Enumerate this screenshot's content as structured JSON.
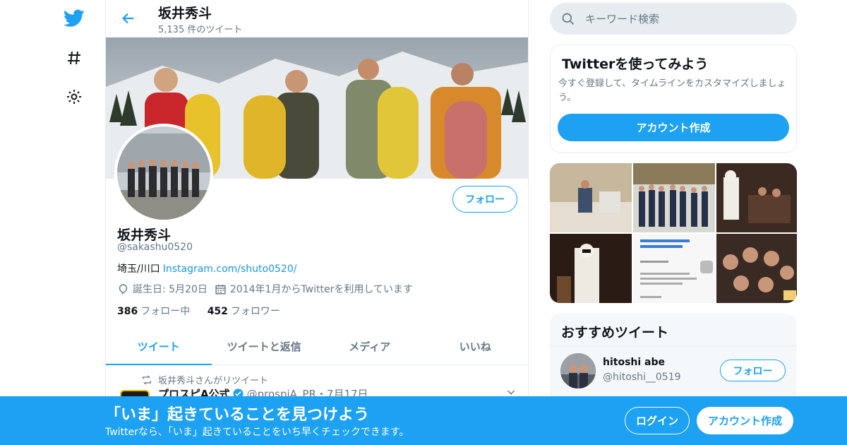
{
  "colors": {
    "accent": "#1da1f2",
    "secondary_text": "#657786",
    "link": "#1b95e0"
  },
  "nav": {
    "icons": [
      "twitter-logo-icon",
      "hashtag-icon",
      "gear-icon"
    ]
  },
  "topbar": {
    "title": "坂井秀斗",
    "subtitle": "5,135 件のツイート"
  },
  "profile": {
    "name": "坂井秀斗",
    "handle": "@sakashu0520",
    "location": "埼玉/川口",
    "link": "Instagram.com/shuto0520/",
    "birthday": "誕生日: 5月20日",
    "joined": "2014年1月からTwitterを利用しています",
    "following_count": "386",
    "following_label": "フォロー中",
    "followers_count": "452",
    "followers_label": "フォロワー",
    "follow_button": "フォロー"
  },
  "tabs": [
    {
      "label": "ツイート",
      "active": true
    },
    {
      "label": "ツイートと返信",
      "active": false
    },
    {
      "label": "メディア",
      "active": false
    },
    {
      "label": "いいね",
      "active": false
    }
  ],
  "tweet": {
    "retweet_text": "坂井秀斗さんがリツイート",
    "author_name": "プロスピA公式",
    "author_meta": "@prospiA_PR・7月17日"
  },
  "sidebar": {
    "search_placeholder": "キーワード検索",
    "signup_card": {
      "title": "Twitterを使ってみよう",
      "desc": "今すぐ登録して、タイムラインをカスタマイズしましょう。",
      "button": "アカウント作成"
    },
    "recommended": {
      "title": "おすすめツイート",
      "user_name": "hitoshi abe",
      "user_handle": "@hitoshi__0519",
      "follow": "フォロー"
    }
  },
  "bottombar": {
    "title": "「いま」起きていることを見つけよう",
    "subtitle": "Twitterなら、「いま」起きていることをいち早くチェックできます。",
    "login": "ログイン",
    "signup": "アカウント作成"
  }
}
